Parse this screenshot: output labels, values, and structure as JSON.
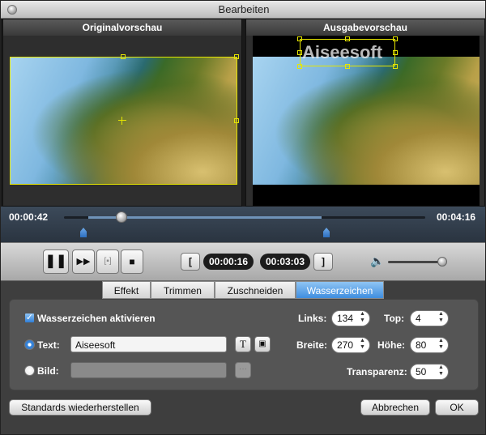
{
  "window": {
    "title": "Bearbeiten"
  },
  "preview": {
    "original_label": "Originalvorschau",
    "output_label": "Ausgabevorschau",
    "watermark_text": "Aiseesoft"
  },
  "timeline": {
    "current_time": "00:00:42",
    "total_time": "00:04:16",
    "progress": 0.16
  },
  "controls": {
    "start_time": "00:00:16",
    "end_time": "00:03:03",
    "start_bracket": "[",
    "end_bracket": "]",
    "volume": 0.93
  },
  "tabs": [
    {
      "label": "Effekt",
      "active": false
    },
    {
      "label": "Trimmen",
      "active": false
    },
    {
      "label": "Zuschneiden",
      "active": false
    },
    {
      "label": "Wasserzeichen",
      "active": true
    }
  ],
  "watermark": {
    "enable_label": "Wasserzeichen aktivieren",
    "text_label": "Text:",
    "text_value": "Aiseesoft",
    "image_label": "Bild:",
    "links_label": "Links:",
    "links_value": "134",
    "top_label": "Top:",
    "top_value": "4",
    "breite_label": "Breite:",
    "breite_value": "270",
    "hoehe_label": "Höhe:",
    "hoehe_value": "80",
    "transparenz_label": "Transparenz:",
    "transparenz_value": "50"
  },
  "footer": {
    "restore_label": "Standards wiederherstellen",
    "cancel_label": "Abbrechen",
    "ok_label": "OK"
  },
  "colors": {
    "accent": "#3f8ee0",
    "selection": "#e6e600"
  }
}
